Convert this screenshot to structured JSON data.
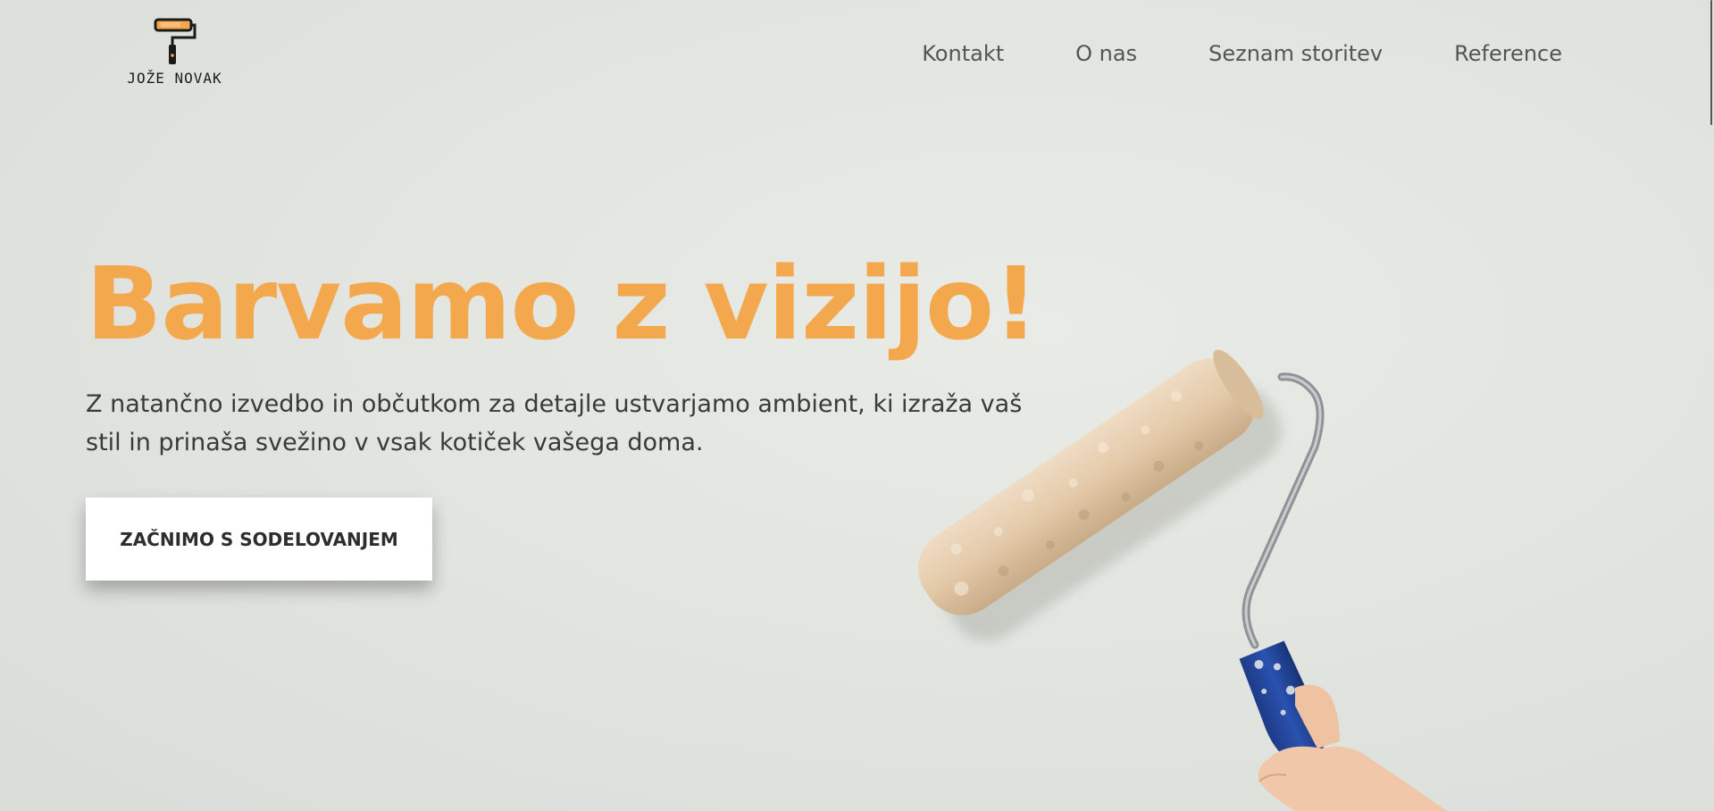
{
  "brand": {
    "name": "JOŽE NOVAK"
  },
  "nav": {
    "items": [
      {
        "label": "Kontakt"
      },
      {
        "label": "O nas"
      },
      {
        "label": "Seznam storitev"
      },
      {
        "label": "Reference"
      }
    ]
  },
  "hero": {
    "title": "Barvamo z vizijo!",
    "subtitle": "Z natančno izvedbo in občutkom za detajle ustvarjamo ambient, ki izraža vaš stil in prinaša svežino v vsak kotiček vašega doma.",
    "cta_label": "ZAČNIMO S SODELOVANJEM"
  },
  "colors": {
    "accent": "#f4a84d",
    "text": "#3a3a3a",
    "nav_text": "#555555",
    "background": "#e2e5e0"
  },
  "icons": {
    "logo": "paint-roller-icon"
  }
}
